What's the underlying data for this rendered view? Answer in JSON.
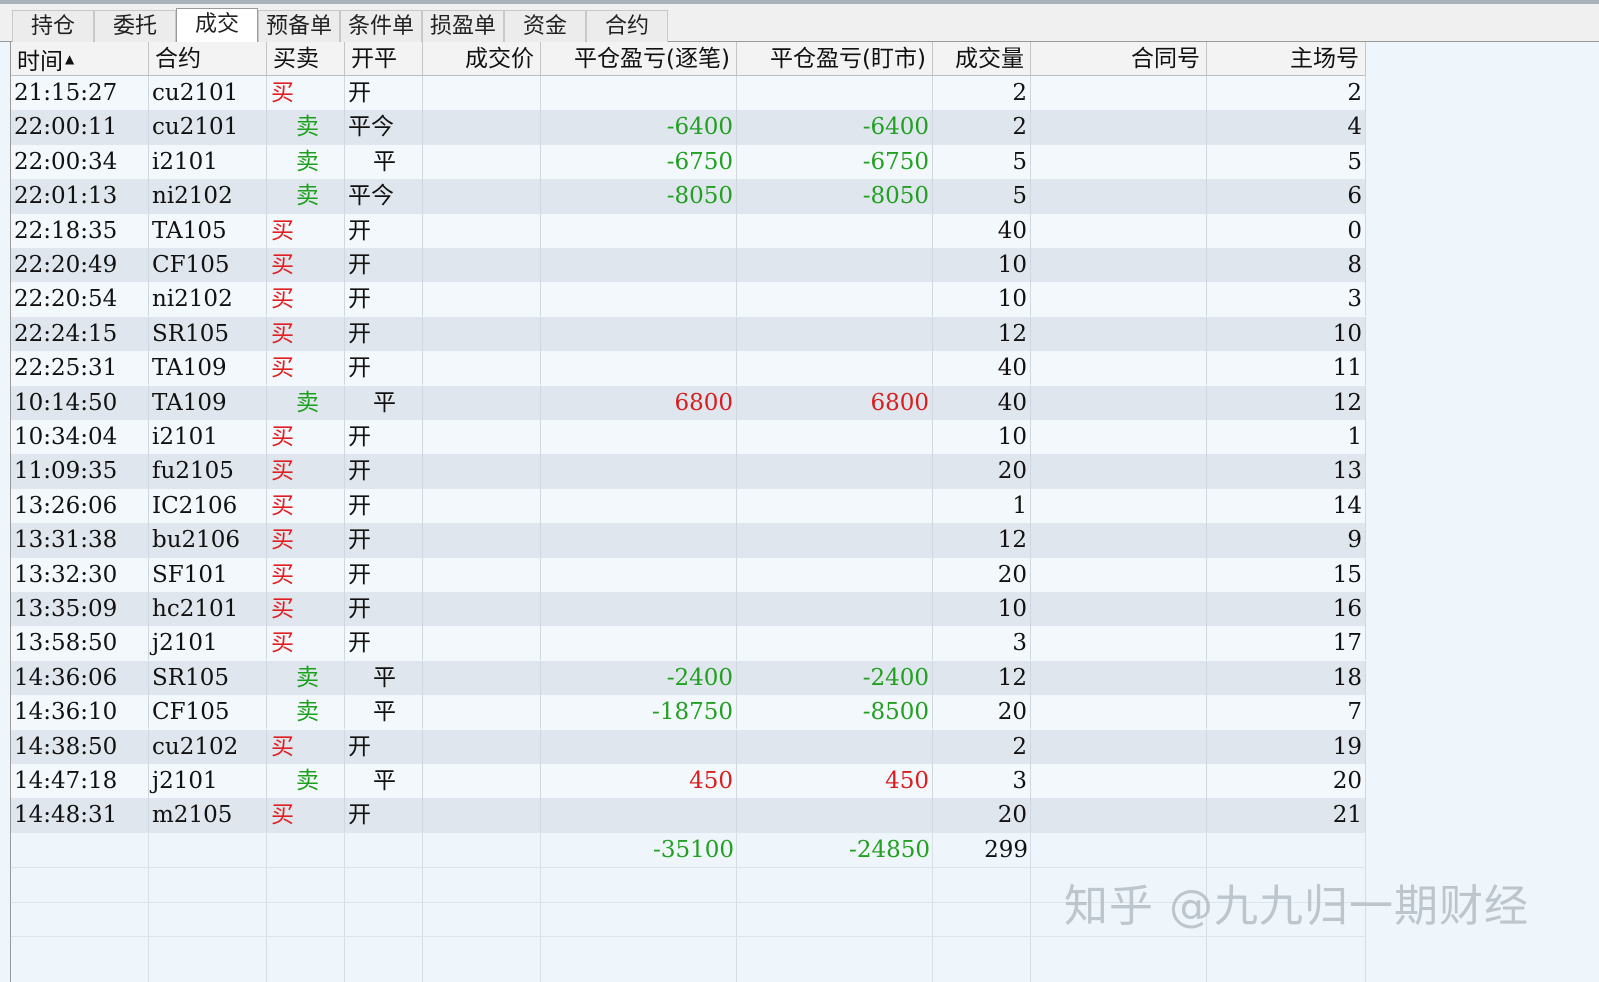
{
  "tabs": [
    {
      "label": "持仓",
      "active": false
    },
    {
      "label": "委托",
      "active": false
    },
    {
      "label": "成交",
      "active": true
    },
    {
      "label": "预备单",
      "active": false
    },
    {
      "label": "条件单",
      "active": false
    },
    {
      "label": "损盈单",
      "active": false
    },
    {
      "label": "资金",
      "active": false
    },
    {
      "label": "合约",
      "active": false
    }
  ],
  "table": {
    "columns": [
      {
        "key": "time",
        "label": "时间",
        "sorted": "asc"
      },
      {
        "key": "contract",
        "label": "合约"
      },
      {
        "key": "side",
        "label": "买卖"
      },
      {
        "key": "openclose",
        "label": "开平"
      },
      {
        "key": "price",
        "label": "成交价"
      },
      {
        "key": "pnl_trade",
        "label": "平仓盈亏(逐笔)"
      },
      {
        "key": "pnl_mark",
        "label": "平仓盈亏(盯市)"
      },
      {
        "key": "volume",
        "label": "成交量"
      },
      {
        "key": "contract_no",
        "label": "合同号"
      },
      {
        "key": "exchange_no",
        "label": "主场号"
      }
    ],
    "rows": [
      {
        "time": "21:15:27",
        "contract": "cu2101",
        "side": "买",
        "openclose": "开",
        "price": "",
        "pnl_trade": "",
        "pnl_mark": "",
        "volume": "2",
        "contract_no": "",
        "exchange_no": "2"
      },
      {
        "time": "22:00:11",
        "contract": "cu2101",
        "side": "卖",
        "openclose": "平今",
        "price": "",
        "pnl_trade": "-6400",
        "pnl_mark": "-6400",
        "volume": "2",
        "contract_no": "",
        "exchange_no": "4"
      },
      {
        "time": "22:00:34",
        "contract": "i2101",
        "side": "卖",
        "openclose": "平",
        "price": "",
        "pnl_trade": "-6750",
        "pnl_mark": "-6750",
        "volume": "5",
        "contract_no": "",
        "exchange_no": "5"
      },
      {
        "time": "22:01:13",
        "contract": "ni2102",
        "side": "卖",
        "openclose": "平今",
        "price": "",
        "pnl_trade": "-8050",
        "pnl_mark": "-8050",
        "volume": "5",
        "contract_no": "",
        "exchange_no": "6"
      },
      {
        "time": "22:18:35",
        "contract": "TA105",
        "side": "买",
        "openclose": "开",
        "price": "",
        "pnl_trade": "",
        "pnl_mark": "",
        "volume": "40",
        "contract_no": "",
        "exchange_no": "0"
      },
      {
        "time": "22:20:49",
        "contract": "CF105",
        "side": "买",
        "openclose": "开",
        "price": "",
        "pnl_trade": "",
        "pnl_mark": "",
        "volume": "10",
        "contract_no": "",
        "exchange_no": "8"
      },
      {
        "time": "22:20:54",
        "contract": "ni2102",
        "side": "买",
        "openclose": "开",
        "price": "",
        "pnl_trade": "",
        "pnl_mark": "",
        "volume": "10",
        "contract_no": "",
        "exchange_no": "3"
      },
      {
        "time": "22:24:15",
        "contract": "SR105",
        "side": "买",
        "openclose": "开",
        "price": "",
        "pnl_trade": "",
        "pnl_mark": "",
        "volume": "12",
        "contract_no": "",
        "exchange_no": "10"
      },
      {
        "time": "22:25:31",
        "contract": "TA109",
        "side": "买",
        "openclose": "开",
        "price": "",
        "pnl_trade": "",
        "pnl_mark": "",
        "volume": "40",
        "contract_no": "",
        "exchange_no": "11"
      },
      {
        "time": "10:14:50",
        "contract": "TA109",
        "side": "卖",
        "openclose": "平",
        "price": "",
        "pnl_trade": "6800",
        "pnl_mark": "6800",
        "volume": "40",
        "contract_no": "",
        "exchange_no": "12"
      },
      {
        "time": "10:34:04",
        "contract": "i2101",
        "side": "买",
        "openclose": "开",
        "price": "",
        "pnl_trade": "",
        "pnl_mark": "",
        "volume": "10",
        "contract_no": "",
        "exchange_no": "1"
      },
      {
        "time": "11:09:35",
        "contract": "fu2105",
        "side": "买",
        "openclose": "开",
        "price": "",
        "pnl_trade": "",
        "pnl_mark": "",
        "volume": "20",
        "contract_no": "",
        "exchange_no": "13"
      },
      {
        "time": "13:26:06",
        "contract": "IC2106",
        "side": "买",
        "openclose": "开",
        "price": "",
        "pnl_trade": "",
        "pnl_mark": "",
        "volume": "1",
        "contract_no": "",
        "exchange_no": "14"
      },
      {
        "time": "13:31:38",
        "contract": "bu2106",
        "side": "买",
        "openclose": "开",
        "price": "",
        "pnl_trade": "",
        "pnl_mark": "",
        "volume": "12",
        "contract_no": "",
        "exchange_no": "9"
      },
      {
        "time": "13:32:30",
        "contract": "SF101",
        "side": "买",
        "openclose": "开",
        "price": "",
        "pnl_trade": "",
        "pnl_mark": "",
        "volume": "20",
        "contract_no": "",
        "exchange_no": "15"
      },
      {
        "time": "13:35:09",
        "contract": "hc2101",
        "side": "买",
        "openclose": "开",
        "price": "",
        "pnl_trade": "",
        "pnl_mark": "",
        "volume": "10",
        "contract_no": "",
        "exchange_no": "16"
      },
      {
        "time": "13:58:50",
        "contract": "j2101",
        "side": "买",
        "openclose": "开",
        "price": "",
        "pnl_trade": "",
        "pnl_mark": "",
        "volume": "3",
        "contract_no": "",
        "exchange_no": "17"
      },
      {
        "time": "14:36:06",
        "contract": "SR105",
        "side": "卖",
        "openclose": "平",
        "price": "",
        "pnl_trade": "-2400",
        "pnl_mark": "-2400",
        "volume": "12",
        "contract_no": "",
        "exchange_no": "18"
      },
      {
        "time": "14:36:10",
        "contract": "CF105",
        "side": "卖",
        "openclose": "平",
        "price": "",
        "pnl_trade": "-18750",
        "pnl_mark": "-8500",
        "volume": "20",
        "contract_no": "",
        "exchange_no": "7"
      },
      {
        "time": "14:38:50",
        "contract": "cu2102",
        "side": "买",
        "openclose": "开",
        "price": "",
        "pnl_trade": "",
        "pnl_mark": "",
        "volume": "2",
        "contract_no": "",
        "exchange_no": "19"
      },
      {
        "time": "14:47:18",
        "contract": "j2101",
        "side": "卖",
        "openclose": "平",
        "price": "",
        "pnl_trade": "450",
        "pnl_mark": "450",
        "volume": "3",
        "contract_no": "",
        "exchange_no": "20"
      },
      {
        "time": "14:48:31",
        "contract": "m2105",
        "side": "买",
        "openclose": "开",
        "price": "",
        "pnl_trade": "",
        "pnl_mark": "",
        "volume": "20",
        "contract_no": "",
        "exchange_no": "21"
      }
    ],
    "totals": {
      "pnl_trade": "-35100",
      "pnl_mark": "-24850",
      "volume": "299"
    }
  },
  "colors": {
    "buy": "#e02020",
    "sell": "#1aa01a",
    "profit": "#d81e1e",
    "loss": "#22a022"
  },
  "watermark": "知乎 @九九归一期财经"
}
